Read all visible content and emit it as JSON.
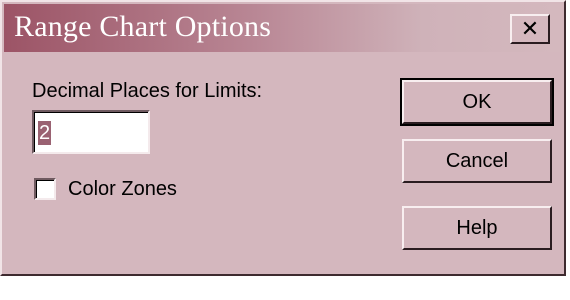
{
  "window": {
    "title": "Range Chart Options",
    "close_glyph": "✕",
    "close_icon": "close-icon"
  },
  "form": {
    "decimal_label": "Decimal Places for Limits:",
    "decimal_value": "2",
    "color_zones_label": "Color Zones",
    "color_zones_checked": false
  },
  "buttons": {
    "ok": "OK",
    "cancel": "Cancel",
    "help": "Help"
  },
  "colors": {
    "dialog_bg": "#d4b7be",
    "title_active": "#9c5466",
    "selection": "#9a6272"
  }
}
